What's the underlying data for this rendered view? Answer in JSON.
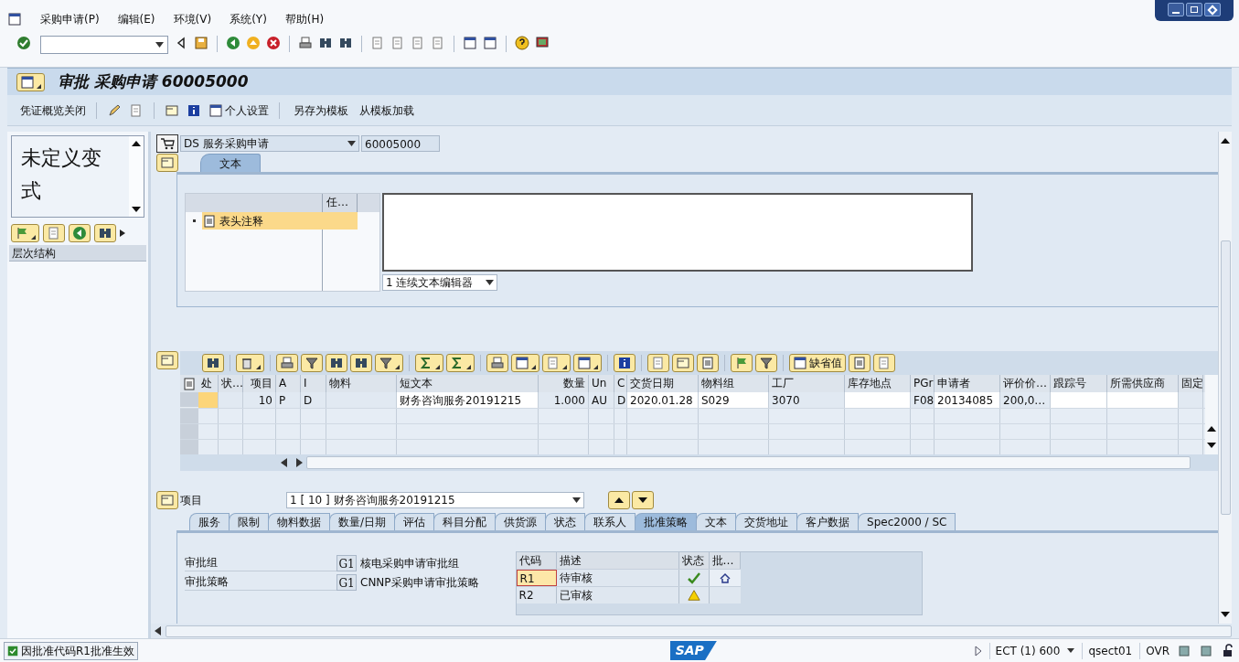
{
  "menu": [
    {
      "label": "采购申请(P)"
    },
    {
      "label": "编辑(E)"
    },
    {
      "label": "环境(V)"
    },
    {
      "label": "系统(Y)"
    },
    {
      "label": "帮助(H)"
    }
  ],
  "title": "审批 采购申请 60005000",
  "app_toolbar": {
    "overview": "凭证概览关闭",
    "personal": "个人设置",
    "save_template": "另存为模板",
    "load_template": "从模板加载"
  },
  "left_panel": {
    "variant": "未定义变式",
    "tree_header": "层次结构"
  },
  "document": {
    "type": "DS 服务采购申请",
    "number": "60005000"
  },
  "header_tabs": [
    {
      "label": "文本",
      "selected": true
    }
  ],
  "text_tree": {
    "column": "任…",
    "items": [
      {
        "label": "表头注释",
        "selected": true
      }
    ]
  },
  "editor_mode": "1 连续文本编辑器",
  "items_toolbar": {
    "defaults": "缺省值"
  },
  "items_table": {
    "columns": [
      {
        "label": "处",
        "editable": false
      },
      {
        "label": "状…",
        "editable": false
      },
      {
        "label": "项目",
        "editable": false
      },
      {
        "label": "A",
        "editable": false
      },
      {
        "label": "I",
        "editable": false
      },
      {
        "label": "物料",
        "editable": false
      },
      {
        "label": "短文本",
        "editable": true
      },
      {
        "label": "数量",
        "editable": false
      },
      {
        "label": "Un",
        "editable": false
      },
      {
        "label": "C",
        "editable": false
      },
      {
        "label": "交货日期",
        "editable": true
      },
      {
        "label": "物料组",
        "editable": true
      },
      {
        "label": "工厂",
        "editable": false
      },
      {
        "label": "库存地点",
        "editable": true
      },
      {
        "label": "PGr",
        "editable": false
      },
      {
        "label": "申请者",
        "editable": true
      },
      {
        "label": "评价价…",
        "editable": false
      },
      {
        "label": "跟踪号",
        "editable": true
      },
      {
        "label": "所需供应商",
        "editable": true
      },
      {
        "label": "固定",
        "editable": false
      }
    ],
    "rows": [
      {
        "marked": true,
        "cells": [
          null,
          null,
          "10",
          "P",
          "D",
          null,
          "财务咨询服务20191215",
          "1.000",
          "AU",
          "D",
          "2020.01.28",
          "S029",
          "3070",
          null,
          "F08",
          "20134085",
          "200,0…",
          null,
          null,
          null
        ]
      }
    ]
  },
  "item_selector": {
    "label": "项目",
    "value": "1 [ 10 ] 财务咨询服务20191215"
  },
  "item_tabs": [
    {
      "label": "服务",
      "selected": false
    },
    {
      "label": "限制",
      "selected": false
    },
    {
      "label": "物料数据",
      "selected": false
    },
    {
      "label": "数量/日期",
      "selected": false
    },
    {
      "label": "评估",
      "selected": false
    },
    {
      "label": "科目分配",
      "selected": false
    },
    {
      "label": "供货源",
      "selected": false
    },
    {
      "label": "状态",
      "selected": false
    },
    {
      "label": "联系人",
      "selected": false
    },
    {
      "label": "批准策略",
      "selected": true
    },
    {
      "label": "文本",
      "selected": false
    },
    {
      "label": "交货地址",
      "selected": false
    },
    {
      "label": "客户数据",
      "selected": false
    },
    {
      "label": "Spec2000 / SC",
      "selected": false
    }
  ],
  "approval": {
    "fields": [
      {
        "label": "审批组",
        "code": "G1",
        "text": "核电采购申请审批组"
      },
      {
        "label": "审批策略",
        "code": "G1",
        "text": "CNNP采购申请审批策略"
      }
    ],
    "codes_table": {
      "columns": [
        "代码",
        "描述",
        "状态",
        "批…"
      ],
      "rows": [
        {
          "code": "R1",
          "description": "待审核",
          "released": true,
          "releasable": true,
          "selected": true
        },
        {
          "code": "R2",
          "description": "已审核",
          "released": false,
          "releasable": false,
          "selected": false
        }
      ]
    }
  },
  "status_bar": {
    "message": "因批准代码R1批准生效",
    "logo": "SAP",
    "system": "ECT (1) 600",
    "user": "qsect01",
    "mode": "OVR"
  }
}
